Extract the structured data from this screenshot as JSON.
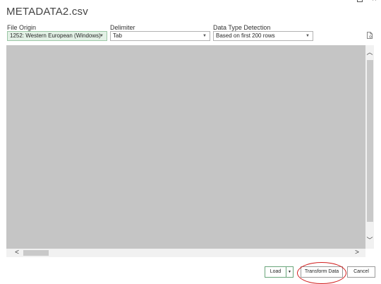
{
  "window": {
    "title": "METADATA2.csv",
    "controls": [
      "restore-icon",
      "close-icon"
    ],
    "close_glyph": "×"
  },
  "settings": {
    "file_origin": {
      "label": "File Origin",
      "value": "1252: Western European (Windows)"
    },
    "delimiter": {
      "label": "Delimiter",
      "value": "Tab"
    },
    "data_type_detection": {
      "label": "Data Type Detection",
      "value": "Based on first 200 rows"
    },
    "caret_glyph": "▼"
  },
  "scrollbars": {
    "up_glyph": "︿",
    "down_glyph": "﹀",
    "left_glyph": "<",
    "right_glyph": ">"
  },
  "buttons": {
    "load": "Load",
    "load_dropdown_glyph": "▼",
    "transform": "Transform Data",
    "cancel": "Cancel"
  },
  "colors": {
    "preview_fill": "#c5c5c5",
    "file_origin_bg": "#e3f1e6",
    "load_border": "#6aa57b",
    "annotation_red": "#d21f1f"
  }
}
